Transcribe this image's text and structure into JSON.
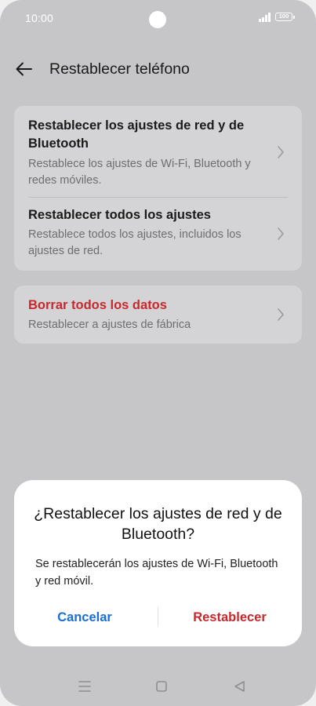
{
  "status_bar": {
    "time": "10:00",
    "battery": "100",
    "icons": [
      "signal-icon",
      "battery-icon"
    ]
  },
  "header": {
    "back_icon": "arrow-left-icon",
    "title": "Restablecer teléfono"
  },
  "settings": {
    "group1": [
      {
        "title": "Restablecer los ajustes de red y de Bluetooth",
        "subtitle": "Restablece los ajustes de Wi-Fi, Bluetooth y redes móviles."
      },
      {
        "title": "Restablecer todos los ajustes",
        "subtitle": "Restablece todos los ajustes, incluidos los ajustes de red."
      }
    ],
    "group2": [
      {
        "title": "Borrar todos los datos",
        "subtitle": "Restablecer a ajustes de fábrica"
      }
    ],
    "chevron_icon": "chevron-right-icon"
  },
  "dialog": {
    "title": "¿Restablecer los ajustes de red y de Bluetooth?",
    "message": "Se restablecerán los ajustes de Wi-Fi, Bluetooth y red móvil.",
    "cancel_label": "Cancelar",
    "confirm_label": "Restablecer"
  },
  "nav_bar": {
    "icons": [
      "menu-icon",
      "home-icon",
      "back-triangle-icon"
    ]
  },
  "colors": {
    "background_dimmed": "#c6c6c8",
    "card": "#d4d4d6",
    "danger": "#c8282c",
    "accent": "#1a6fd1"
  }
}
